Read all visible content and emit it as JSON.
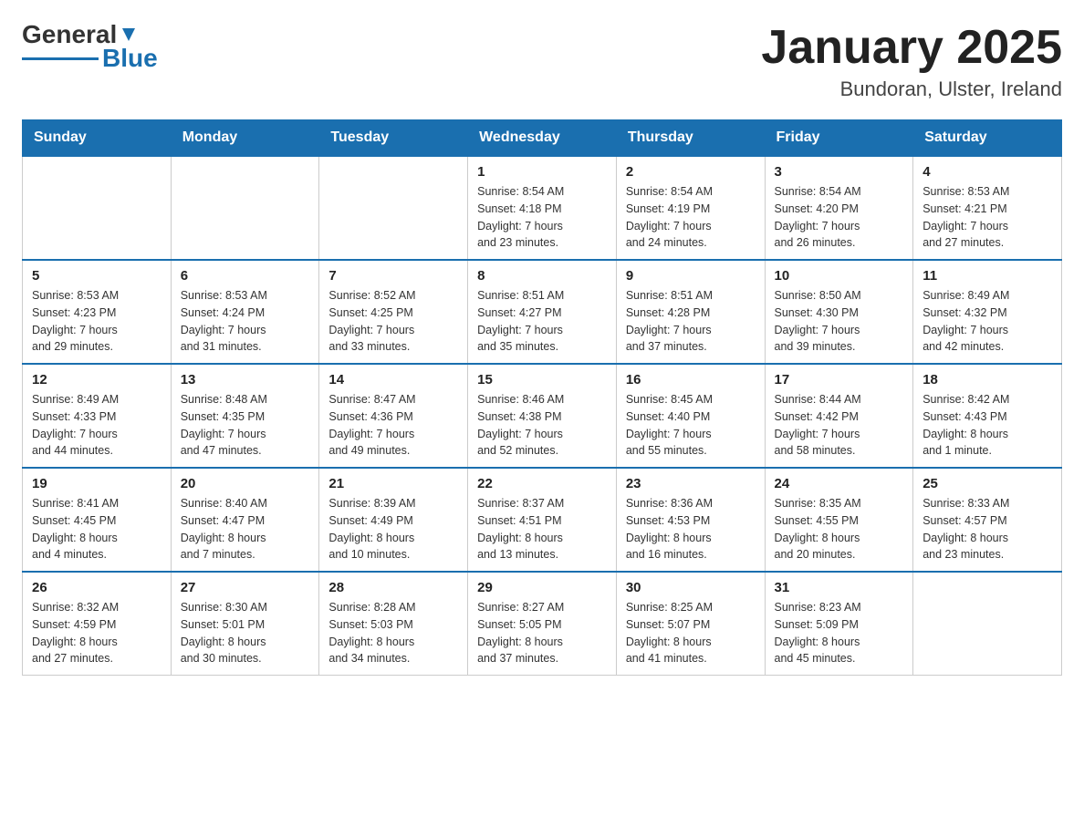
{
  "logo": {
    "text_general": "General",
    "text_blue": "Blue"
  },
  "header": {
    "month_title": "January 2025",
    "subtitle": "Bundoran, Ulster, Ireland"
  },
  "weekdays": [
    "Sunday",
    "Monday",
    "Tuesday",
    "Wednesday",
    "Thursday",
    "Friday",
    "Saturday"
  ],
  "weeks": [
    [
      {
        "day": "",
        "info": ""
      },
      {
        "day": "",
        "info": ""
      },
      {
        "day": "",
        "info": ""
      },
      {
        "day": "1",
        "info": "Sunrise: 8:54 AM\nSunset: 4:18 PM\nDaylight: 7 hours\nand 23 minutes."
      },
      {
        "day": "2",
        "info": "Sunrise: 8:54 AM\nSunset: 4:19 PM\nDaylight: 7 hours\nand 24 minutes."
      },
      {
        "day": "3",
        "info": "Sunrise: 8:54 AM\nSunset: 4:20 PM\nDaylight: 7 hours\nand 26 minutes."
      },
      {
        "day": "4",
        "info": "Sunrise: 8:53 AM\nSunset: 4:21 PM\nDaylight: 7 hours\nand 27 minutes."
      }
    ],
    [
      {
        "day": "5",
        "info": "Sunrise: 8:53 AM\nSunset: 4:23 PM\nDaylight: 7 hours\nand 29 minutes."
      },
      {
        "day": "6",
        "info": "Sunrise: 8:53 AM\nSunset: 4:24 PM\nDaylight: 7 hours\nand 31 minutes."
      },
      {
        "day": "7",
        "info": "Sunrise: 8:52 AM\nSunset: 4:25 PM\nDaylight: 7 hours\nand 33 minutes."
      },
      {
        "day": "8",
        "info": "Sunrise: 8:51 AM\nSunset: 4:27 PM\nDaylight: 7 hours\nand 35 minutes."
      },
      {
        "day": "9",
        "info": "Sunrise: 8:51 AM\nSunset: 4:28 PM\nDaylight: 7 hours\nand 37 minutes."
      },
      {
        "day": "10",
        "info": "Sunrise: 8:50 AM\nSunset: 4:30 PM\nDaylight: 7 hours\nand 39 minutes."
      },
      {
        "day": "11",
        "info": "Sunrise: 8:49 AM\nSunset: 4:32 PM\nDaylight: 7 hours\nand 42 minutes."
      }
    ],
    [
      {
        "day": "12",
        "info": "Sunrise: 8:49 AM\nSunset: 4:33 PM\nDaylight: 7 hours\nand 44 minutes."
      },
      {
        "day": "13",
        "info": "Sunrise: 8:48 AM\nSunset: 4:35 PM\nDaylight: 7 hours\nand 47 minutes."
      },
      {
        "day": "14",
        "info": "Sunrise: 8:47 AM\nSunset: 4:36 PM\nDaylight: 7 hours\nand 49 minutes."
      },
      {
        "day": "15",
        "info": "Sunrise: 8:46 AM\nSunset: 4:38 PM\nDaylight: 7 hours\nand 52 minutes."
      },
      {
        "day": "16",
        "info": "Sunrise: 8:45 AM\nSunset: 4:40 PM\nDaylight: 7 hours\nand 55 minutes."
      },
      {
        "day": "17",
        "info": "Sunrise: 8:44 AM\nSunset: 4:42 PM\nDaylight: 7 hours\nand 58 minutes."
      },
      {
        "day": "18",
        "info": "Sunrise: 8:42 AM\nSunset: 4:43 PM\nDaylight: 8 hours\nand 1 minute."
      }
    ],
    [
      {
        "day": "19",
        "info": "Sunrise: 8:41 AM\nSunset: 4:45 PM\nDaylight: 8 hours\nand 4 minutes."
      },
      {
        "day": "20",
        "info": "Sunrise: 8:40 AM\nSunset: 4:47 PM\nDaylight: 8 hours\nand 7 minutes."
      },
      {
        "day": "21",
        "info": "Sunrise: 8:39 AM\nSunset: 4:49 PM\nDaylight: 8 hours\nand 10 minutes."
      },
      {
        "day": "22",
        "info": "Sunrise: 8:37 AM\nSunset: 4:51 PM\nDaylight: 8 hours\nand 13 minutes."
      },
      {
        "day": "23",
        "info": "Sunrise: 8:36 AM\nSunset: 4:53 PM\nDaylight: 8 hours\nand 16 minutes."
      },
      {
        "day": "24",
        "info": "Sunrise: 8:35 AM\nSunset: 4:55 PM\nDaylight: 8 hours\nand 20 minutes."
      },
      {
        "day": "25",
        "info": "Sunrise: 8:33 AM\nSunset: 4:57 PM\nDaylight: 8 hours\nand 23 minutes."
      }
    ],
    [
      {
        "day": "26",
        "info": "Sunrise: 8:32 AM\nSunset: 4:59 PM\nDaylight: 8 hours\nand 27 minutes."
      },
      {
        "day": "27",
        "info": "Sunrise: 8:30 AM\nSunset: 5:01 PM\nDaylight: 8 hours\nand 30 minutes."
      },
      {
        "day": "28",
        "info": "Sunrise: 8:28 AM\nSunset: 5:03 PM\nDaylight: 8 hours\nand 34 minutes."
      },
      {
        "day": "29",
        "info": "Sunrise: 8:27 AM\nSunset: 5:05 PM\nDaylight: 8 hours\nand 37 minutes."
      },
      {
        "day": "30",
        "info": "Sunrise: 8:25 AM\nSunset: 5:07 PM\nDaylight: 8 hours\nand 41 minutes."
      },
      {
        "day": "31",
        "info": "Sunrise: 8:23 AM\nSunset: 5:09 PM\nDaylight: 8 hours\nand 45 minutes."
      },
      {
        "day": "",
        "info": ""
      }
    ]
  ]
}
